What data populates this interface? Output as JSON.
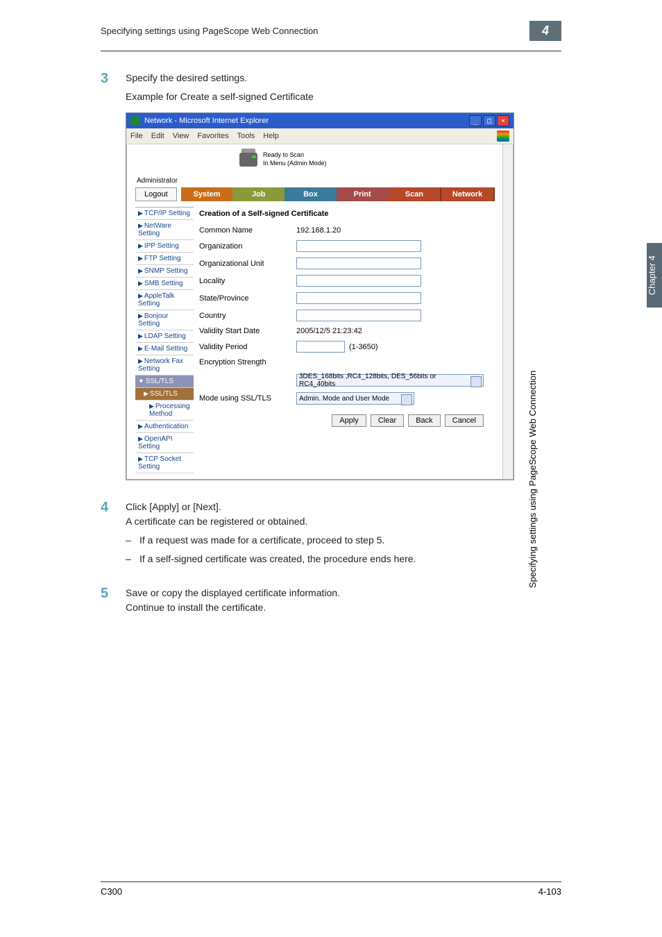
{
  "page": {
    "header_title": "Specifying settings using PageScope Web Connection",
    "chapter_num": "4",
    "footer_left": "C300",
    "footer_right": "4-103"
  },
  "side": {
    "tab": "Chapter 4",
    "label": "Specifying settings using PageScope Web Connection"
  },
  "steps": {
    "s3": {
      "num": "3",
      "l1": "Specify the desired settings.",
      "l2": "Example for Create a self-signed Certificate"
    },
    "s4": {
      "num": "4",
      "l1": "Click [Apply] or [Next].",
      "l2": "A certificate can be registered or obtained.",
      "b1": "If a request was made for a certificate, proceed to step 5.",
      "b2": "If a self-signed certificate was created, the procedure ends here."
    },
    "s5": {
      "num": "5",
      "l1": "Save or copy the displayed certificate information.",
      "l2": "Continue to install the certificate."
    }
  },
  "ie": {
    "title": "Network - Microsoft Internet Explorer",
    "menu": {
      "file": "File",
      "edit": "Edit",
      "view": "View",
      "favorites": "Favorites",
      "tools": "Tools",
      "help": "Help"
    },
    "status1": "Ready to Scan",
    "status2": "In Menu (Admin Mode)",
    "admin_label": "Administrator",
    "logout": "Logout",
    "tabs": {
      "system": "System",
      "job": "Job",
      "box": "Box",
      "print": "Print",
      "scan": "Scan",
      "network": "Network"
    },
    "sidebar": {
      "tcpip": "TCP/IP Setting",
      "netware": "NetWare Setting",
      "ipp": "IPP Setting",
      "ftp": "FTP Setting",
      "snmp": "SNMP Setting",
      "smb": "SMB Setting",
      "appletalk": "AppleTalk Setting",
      "bonjour": "Bonjour Setting",
      "ldap": "LDAP Setting",
      "email": "E-Mail Setting",
      "networkfax": "Network Fax Setting",
      "ssltls_group": "SSL/TLS",
      "ssltls": "SSL/TLS",
      "processing": "Processing Method",
      "auth": "Authentication",
      "openapi": "OpenAPI Setting",
      "tcpsocket": "TCP Socket Setting"
    },
    "form": {
      "heading": "Creation of a Self-signed Certificate",
      "f1": "Common Name",
      "f1v": "192.168.1.20",
      "f2": "Organization",
      "f3": "Organizational Unit",
      "f4": "Locality",
      "f5": "State/Province",
      "f6": "Country",
      "f7": "Validity Start Date",
      "f7v": "2005/12/5 21:23:42",
      "f8": "Validity Period",
      "f8v": "",
      "f8r": "(1-3650)",
      "f9": "Encryption Strength",
      "f9v": "3DES_168bits ,RC4_128bits, DES_56bits or RC4_40bits",
      "f10": "Mode using SSL/TLS",
      "f10v": "Admin. Mode and User Mode",
      "btn_apply": "Apply",
      "btn_clear": "Clear",
      "btn_back": "Back",
      "btn_cancel": "Cancel"
    }
  }
}
